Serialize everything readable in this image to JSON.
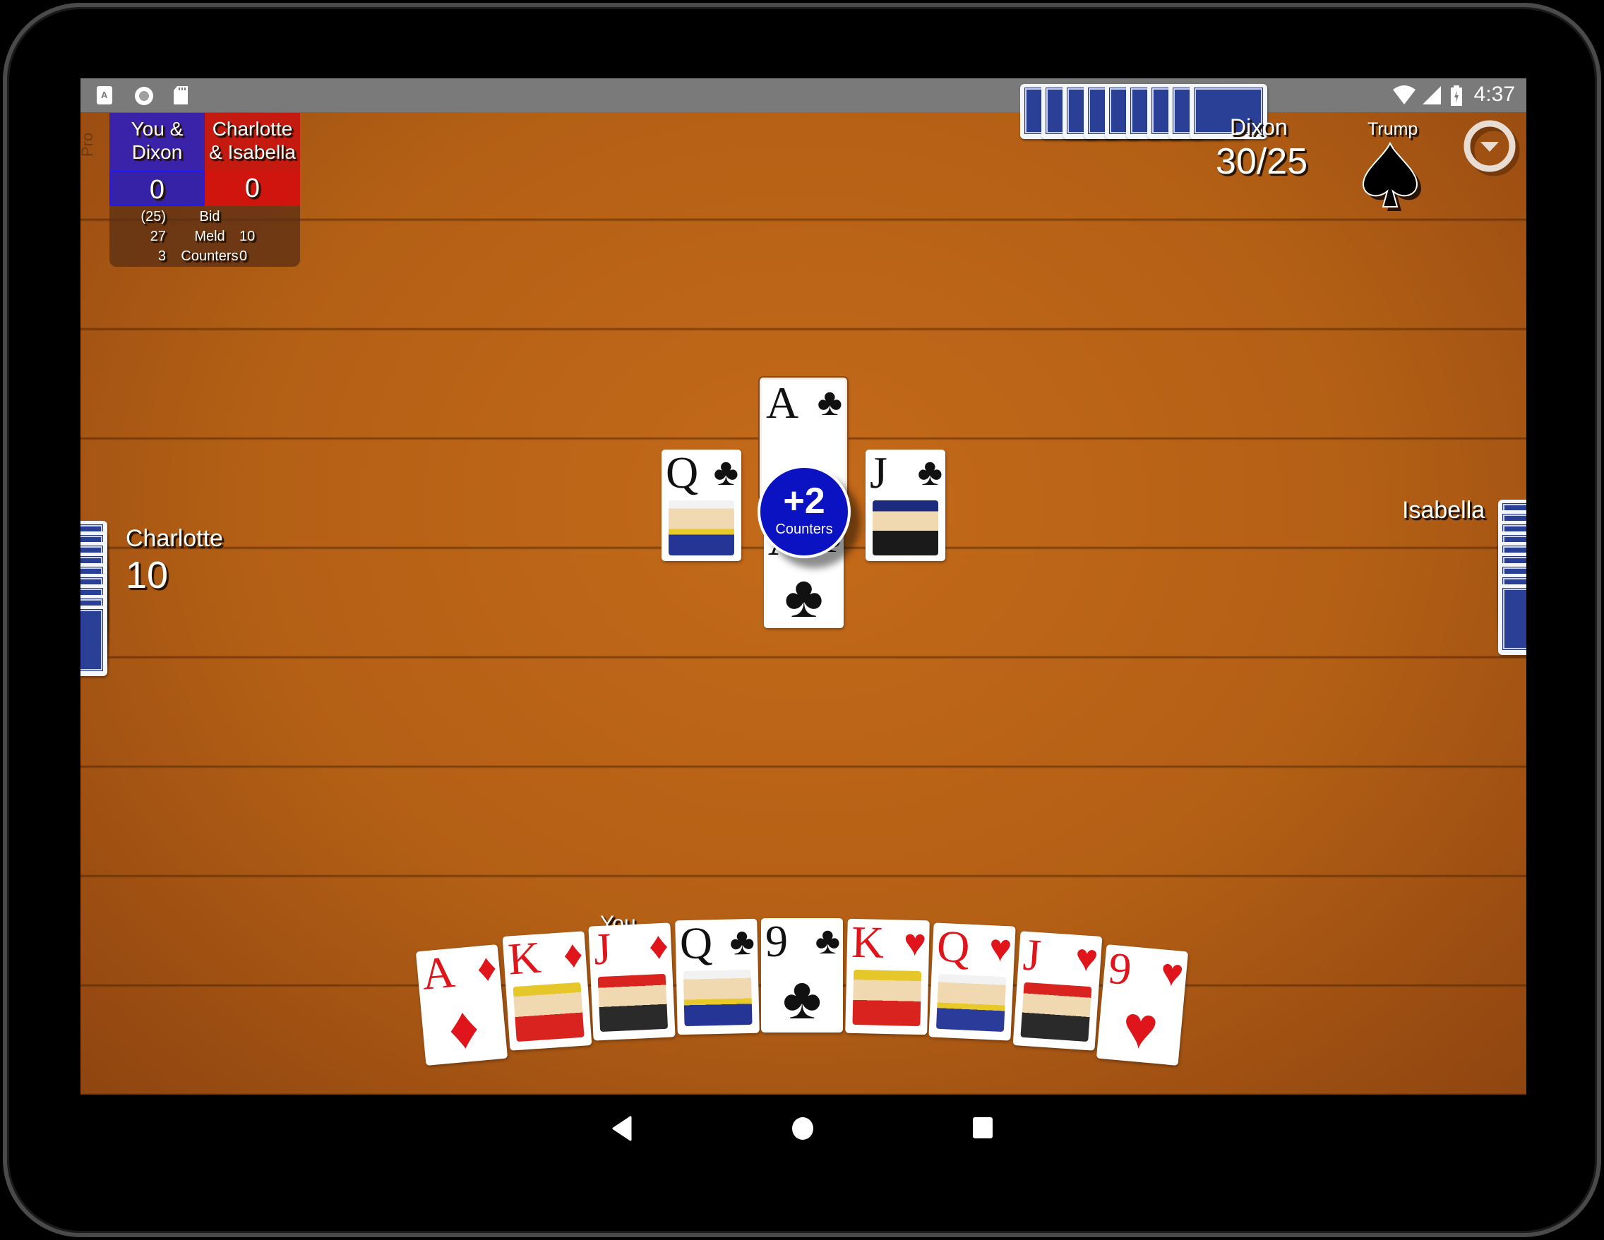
{
  "status_bar": {
    "time": "4:37",
    "left_icons": [
      "text-notification-icon",
      "record-icon",
      "sd-card-icon"
    ],
    "right_icons": [
      "wifi-icon",
      "cell-signal-icon",
      "battery-charging-icon"
    ]
  },
  "score_panel": {
    "mode_label": "Pro",
    "team_a": {
      "name_line1": "You &",
      "name_line2": "Dixon",
      "score": "0",
      "color": "#3a23a8"
    },
    "team_b": {
      "name_line1": "Charlotte",
      "name_line2": "& Isabella",
      "score": "0",
      "color": "#c41a10"
    },
    "rows": [
      {
        "a": "(25)",
        "label": "Bid",
        "b": ""
      },
      {
        "a": "27",
        "label": "Meld",
        "b": "10"
      },
      {
        "a": "3",
        "label": "Counters",
        "b": "0"
      }
    ]
  },
  "players": {
    "top": {
      "name": "Dixon",
      "score": "30/25"
    },
    "left": {
      "name": "Charlotte",
      "score": "10"
    },
    "right": {
      "name": "Isabella"
    },
    "bottom": {
      "name": "You"
    }
  },
  "trump": {
    "label": "Trump",
    "suit": "♠",
    "suit_name": "spades"
  },
  "menu_button": {
    "icon": "dropdown-menu-icon"
  },
  "trick": {
    "top": {
      "rank": "A",
      "suit": "♣",
      "color": "blk"
    },
    "left": {
      "rank": "Q",
      "suit": "♣",
      "color": "blk"
    },
    "right": {
      "rank": "J",
      "suit": "♣",
      "color": "blk"
    },
    "bottom": {
      "rank": "A",
      "suit": "♣",
      "color": "blk"
    }
  },
  "counter_badge": {
    "value": "+2",
    "label": "Counters",
    "color": "#0b12c2"
  },
  "hand": [
    {
      "rank": "A",
      "suit": "♦",
      "color": "red",
      "face": ""
    },
    {
      "rank": "K",
      "suit": "♦",
      "color": "red",
      "face": "k"
    },
    {
      "rank": "J",
      "suit": "♦",
      "color": "red",
      "face": "j"
    },
    {
      "rank": "Q",
      "suit": "♣",
      "color": "blk",
      "face": "qc"
    },
    {
      "rank": "9",
      "suit": "♣",
      "color": "blk",
      "face": ""
    },
    {
      "rank": "K",
      "suit": "♥",
      "color": "red",
      "face": "k"
    },
    {
      "rank": "Q",
      "suit": "♥",
      "color": "red",
      "face": "q"
    },
    {
      "rank": "J",
      "suit": "♥",
      "color": "red",
      "face": "j"
    },
    {
      "rank": "9",
      "suit": "♥",
      "color": "red",
      "face": ""
    }
  ],
  "opponent_hands": {
    "top_count": 9,
    "left_count": 9,
    "right_count": 9
  }
}
